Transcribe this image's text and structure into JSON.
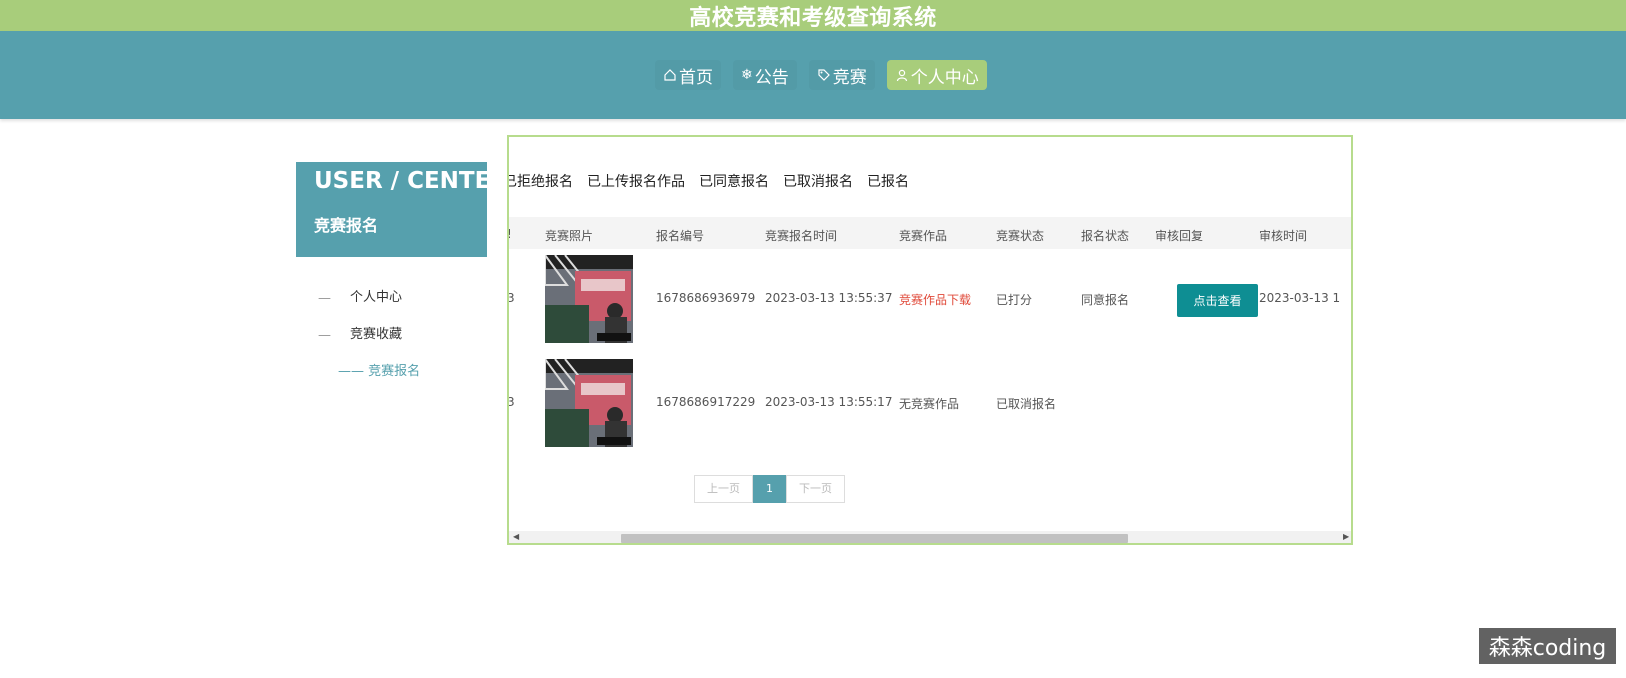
{
  "site_title": "高校竞赛和考级查询系统",
  "nav": [
    {
      "label": "首页",
      "icon": "home-icon"
    },
    {
      "label": "公告",
      "icon": "snowflake-icon"
    },
    {
      "label": "竞赛",
      "icon": "tag-icon"
    },
    {
      "label": "个人中心",
      "icon": "user-icon",
      "active": true
    }
  ],
  "sidebar": {
    "heading": "USER / CENTER",
    "subheading": "竞赛报名",
    "items": [
      {
        "label": "个人中心"
      },
      {
        "label": "竞赛收藏"
      },
      {
        "label": "—— 竞赛报名",
        "active": true
      }
    ]
  },
  "filters": [
    "已拒绝报名",
    "已上传报名作品",
    "已同意报名",
    "已取消报名",
    "已报名"
  ],
  "table": {
    "headers": [
      "竞赛照片",
      "报名编号",
      "竞赛报名时间",
      "竞赛作品",
      "竞赛状态",
      "报名状态",
      "审核回复",
      "审核时间"
    ],
    "rows": [
      {
        "number": "1678686936979",
        "time": "2023-03-13 13:55:37",
        "work": "竞赛作品下载",
        "status": "已打分",
        "signup_status": "同意报名",
        "reply": "点击查看",
        "review_time": "2023-03-13 1"
      },
      {
        "number": "1678686917229",
        "time": "2023-03-13 13:55:17",
        "work": "无竞赛作品",
        "status": "已取消报名",
        "signup_status": "",
        "reply": "",
        "review_time": ""
      }
    ]
  },
  "pagination": {
    "prev": "上一页",
    "current": "1",
    "next": "下一页"
  },
  "watermark": "森森coding",
  "colors": {
    "accent_green": "#a8cd7b",
    "accent_teal": "#56a0ad",
    "button": "#0e8e93",
    "link_red": "#e04a3a"
  }
}
